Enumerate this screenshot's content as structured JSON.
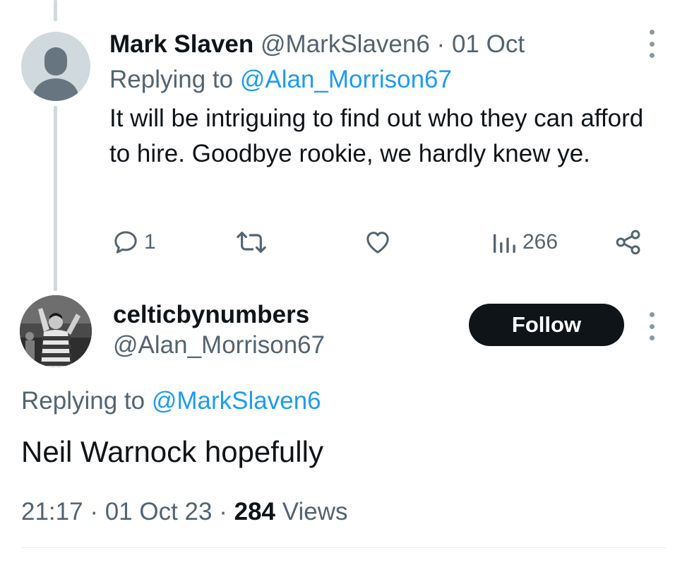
{
  "reply_tweet": {
    "display_name": "Mark Slaven",
    "handle": "@MarkSlaven6",
    "separator": "·",
    "date": "01 Oct",
    "replying_prefix": "Replying to",
    "replying_to": "@Alan_Morrison67",
    "text": "It will be intriguing to find out who they can afford to hire. Goodbye rookie, we hardly knew ye.",
    "actions": {
      "reply_count": "1",
      "views_count": "266"
    },
    "icons": [
      "reply-icon",
      "retweet-icon",
      "like-icon",
      "views-icon",
      "share-icon",
      "more-icon"
    ]
  },
  "main_tweet": {
    "display_name": "celticbynumbers",
    "handle": "@Alan_Morrison67",
    "follow_label": "Follow",
    "replying_prefix": "Replying to",
    "replying_to": "@MarkSlaven6",
    "text": "Neil Warnock hopefully",
    "time": "21:17",
    "separator": "·",
    "date": "01 Oct 23",
    "views_count": "284",
    "views_label": "Views"
  },
  "colors": {
    "text": "#0f1419",
    "muted": "#536471",
    "link": "#1d9bf0",
    "thread_line": "#cfd9de",
    "follow_bg": "#0f1419"
  }
}
